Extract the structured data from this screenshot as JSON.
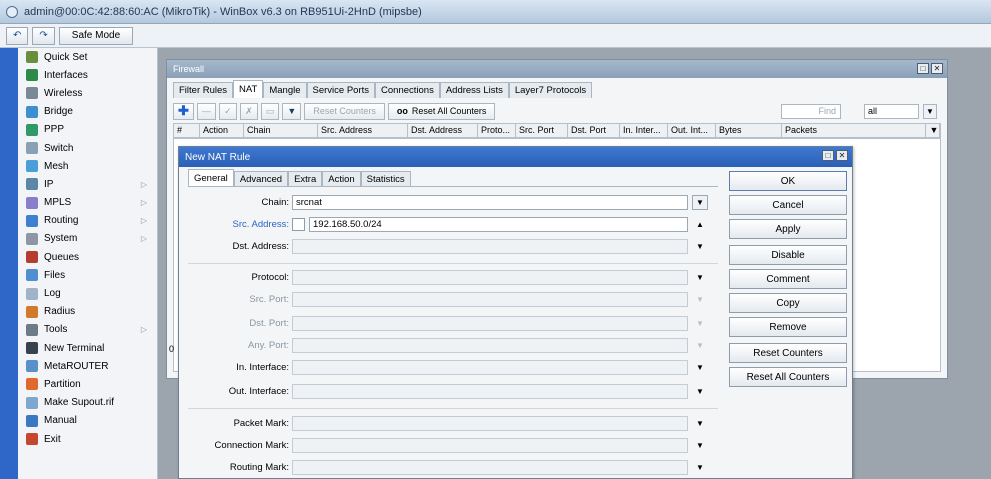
{
  "window": {
    "title": "admin@00:0C:42:88:60:AC (MikroTik) - WinBox v6.3 on RB951Ui-2HnD (mipsbe)"
  },
  "toolbar": {
    "back_glyph": "↶",
    "forward_glyph": "↷",
    "safe_mode_label": "Safe Mode"
  },
  "sidebar": {
    "items": [
      {
        "label": "Quick Set",
        "icon": "quick-set-icon",
        "color": "#6a8f3c",
        "arrow": false
      },
      {
        "label": "Interfaces",
        "icon": "interfaces-icon",
        "color": "#2d8a4a",
        "arrow": false
      },
      {
        "label": "Wireless",
        "icon": "wireless-icon",
        "color": "#7a8794",
        "arrow": false
      },
      {
        "label": "Bridge",
        "icon": "bridge-icon",
        "color": "#3c8fd0",
        "arrow": false
      },
      {
        "label": "PPP",
        "icon": "ppp-icon",
        "color": "#2f9a66",
        "arrow": false
      },
      {
        "label": "Switch",
        "icon": "switch-icon",
        "color": "#8aa0b5",
        "arrow": false
      },
      {
        "label": "Mesh",
        "icon": "mesh-icon",
        "color": "#4a9fd8",
        "arrow": false
      },
      {
        "label": "IP",
        "icon": "ip-icon",
        "color": "#5a86a8",
        "arrow": true
      },
      {
        "label": "MPLS",
        "icon": "mpls-icon",
        "color": "#8a7ec8",
        "arrow": true
      },
      {
        "label": "Routing",
        "icon": "routing-icon",
        "color": "#3f7fd0",
        "arrow": true
      },
      {
        "label": "System",
        "icon": "system-icon",
        "color": "#8c97a3",
        "arrow": true
      },
      {
        "label": "Queues",
        "icon": "queues-icon",
        "color": "#b53c2e",
        "arrow": false
      },
      {
        "label": "Files",
        "icon": "files-icon",
        "color": "#4f8fd0",
        "arrow": false
      },
      {
        "label": "Log",
        "icon": "log-icon",
        "color": "#9fb4c8",
        "arrow": false
      },
      {
        "label": "Radius",
        "icon": "radius-icon",
        "color": "#d07a2e",
        "arrow": false
      },
      {
        "label": "Tools",
        "icon": "tools-icon",
        "color": "#6d7a87",
        "arrow": true
      },
      {
        "label": "New Terminal",
        "icon": "terminal-icon",
        "color": "#38424c",
        "arrow": false
      },
      {
        "label": "MetaROUTER",
        "icon": "metarouter-icon",
        "color": "#5b8fc8",
        "arrow": false
      },
      {
        "label": "Partition",
        "icon": "partition-icon",
        "color": "#e06a2c",
        "arrow": false
      },
      {
        "label": "Make Supout.rif",
        "icon": "supout-icon",
        "color": "#7fa6cf",
        "arrow": false
      },
      {
        "label": "Manual",
        "icon": "manual-icon",
        "color": "#3a78c4",
        "arrow": false
      },
      {
        "label": "Exit",
        "icon": "exit-icon",
        "color": "#c4472e",
        "arrow": false
      }
    ],
    "arrow_glyph": "▷"
  },
  "firewall": {
    "title": "Firewall",
    "win_restore": "□",
    "win_close": "✕",
    "tabs": [
      "Filter Rules",
      "NAT",
      "Mangle",
      "Service Ports",
      "Connections",
      "Address Lists",
      "Layer7 Protocols"
    ],
    "active_tab": "NAT",
    "toolbar": {
      "add": "✚",
      "remove": "—",
      "enable": "✓",
      "disable": "✗",
      "comment": "▭",
      "filter": "▼",
      "reset_counters": "Reset Counters",
      "reset_all_counters": "Reset All Counters",
      "oo": "oo",
      "find_placeholder": "Find",
      "filter_value": "all",
      "dropdown": "▼"
    },
    "columns": [
      "#",
      "Action",
      "Chain",
      "Src. Address",
      "Dst. Address",
      "Proto...",
      "Src. Port",
      "Dst. Port",
      "In. Inter...",
      "Out. Int...",
      "Bytes",
      "Packets"
    ],
    "status_zero": "0"
  },
  "nat_rule": {
    "title": "New NAT Rule",
    "win_restore": "□",
    "win_close": "✕",
    "tabs": [
      "General",
      "Advanced",
      "Extra",
      "Action",
      "Statistics"
    ],
    "active_tab": "General",
    "fields": {
      "chain": {
        "label": "Chain:",
        "value": "srcnat"
      },
      "src_address": {
        "label": "Src. Address:",
        "value": "192.168.50.0/24"
      },
      "dst_address": {
        "label": "Dst. Address:",
        "value": ""
      },
      "protocol": {
        "label": "Protocol:",
        "value": ""
      },
      "src_port": {
        "label": "Src. Port:",
        "value": ""
      },
      "dst_port": {
        "label": "Dst. Port:",
        "value": ""
      },
      "any_port": {
        "label": "Any. Port:",
        "value": ""
      },
      "in_interface": {
        "label": "In. Interface:",
        "value": ""
      },
      "out_interface": {
        "label": "Out. Interface:",
        "value": ""
      },
      "packet_mark": {
        "label": "Packet Mark:",
        "value": ""
      },
      "connection_mark": {
        "label": "Connection Mark:",
        "value": ""
      },
      "routing_mark": {
        "label": "Routing Mark:",
        "value": ""
      }
    },
    "glyphs": {
      "dropdown": "▼",
      "up": "▲",
      "select": "▼"
    },
    "buttons": {
      "ok": "OK",
      "cancel": "Cancel",
      "apply": "Apply",
      "disable": "Disable",
      "comment": "Comment",
      "copy": "Copy",
      "remove": "Remove",
      "reset_counters": "Reset Counters",
      "reset_all_counters": "Reset All Counters"
    }
  }
}
